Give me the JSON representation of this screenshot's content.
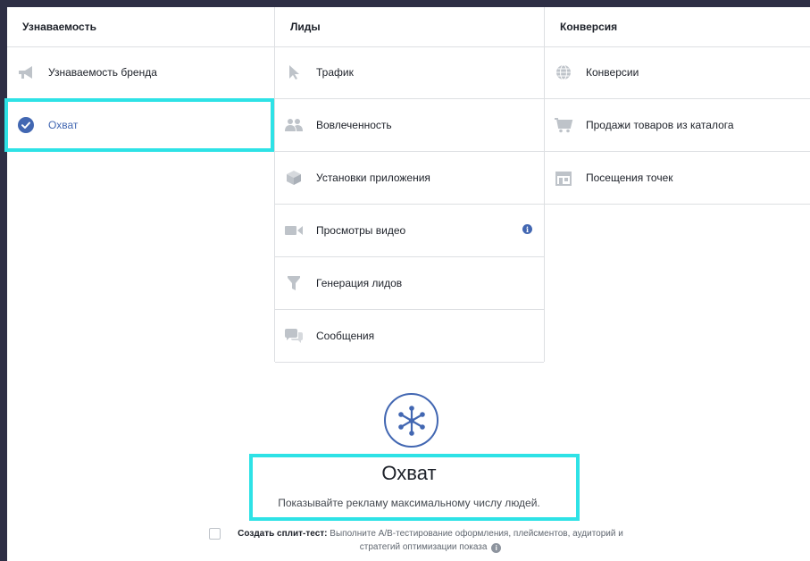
{
  "columns": [
    {
      "header": "Узнаваемость",
      "items": [
        {
          "label": "Узнаваемость бренда",
          "icon": "megaphone-icon",
          "selected": false
        },
        {
          "label": "Охват",
          "icon": "checkmark-circle-icon",
          "selected": true
        }
      ]
    },
    {
      "header": "Лиды",
      "items": [
        {
          "label": "Трафик",
          "icon": "cursor-icon"
        },
        {
          "label": "Вовлеченность",
          "icon": "people-icon"
        },
        {
          "label": "Установки приложения",
          "icon": "box-icon"
        },
        {
          "label": "Просмотры видео",
          "icon": "video-camera-icon",
          "info": "i"
        },
        {
          "label": "Генерация лидов",
          "icon": "funnel-icon"
        },
        {
          "label": "Сообщения",
          "icon": "chat-bubbles-icon"
        }
      ]
    },
    {
      "header": "Конверсия",
      "items": [
        {
          "label": "Конверсии",
          "icon": "globe-icon"
        },
        {
          "label": "Продажи товаров из каталога",
          "icon": "shopping-cart-icon"
        },
        {
          "label": "Посещения точек",
          "icon": "store-icon"
        }
      ]
    }
  ],
  "objective": {
    "icon": "reach-asterisk-icon",
    "title": "Охват",
    "description": "Показывайте рекламу максимальному числу людей."
  },
  "split_test": {
    "label": "Создать сплит-тест:",
    "text": "Выполните A/B-тестирование оформления, плейсментов, аудиторий и стратегий оптимизации показа",
    "help": "i"
  },
  "colors": {
    "accent": "#4267b2",
    "highlight": "#2ee2e6",
    "icon_gray": "#bec3c9",
    "border": "#dddfe2",
    "background_dark": "#2e2f45"
  }
}
